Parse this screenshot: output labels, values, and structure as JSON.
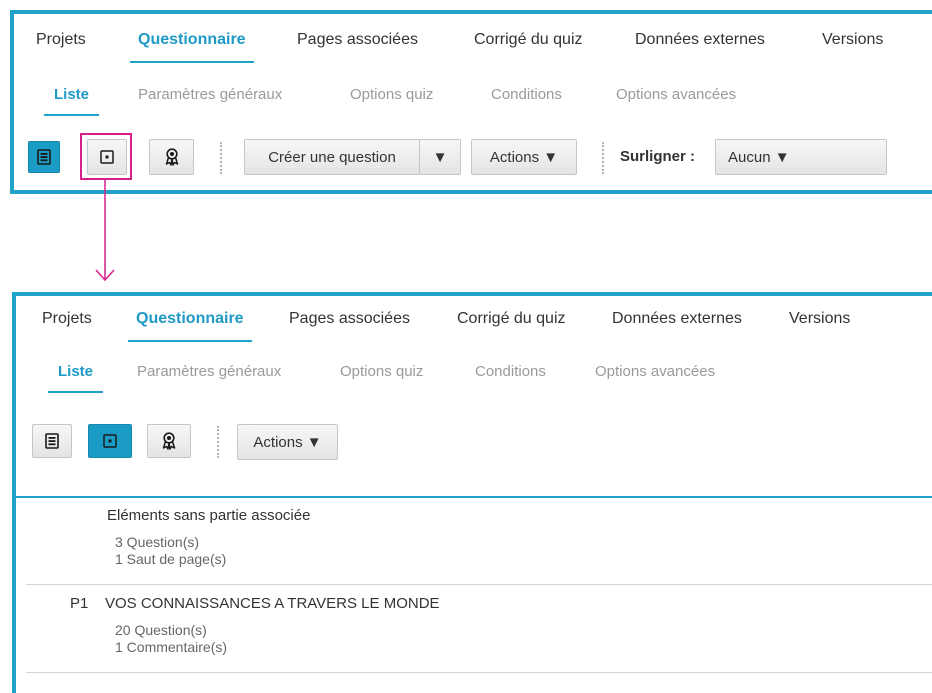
{
  "tabs": [
    "Projets",
    "Questionnaire",
    "Pages associées",
    "Corrigé du quiz",
    "Données externes",
    "Versions"
  ],
  "subtabs": [
    "Liste",
    "Paramètres généraux",
    "Options quiz",
    "Conditions",
    "Options avancées"
  ],
  "toolbar": {
    "create_label": "Créer une question",
    "dropdown_arrow": "▼",
    "actions_label": "Actions ▼",
    "highlight_label": "Surligner :",
    "highlight_value": "Aucun ▼"
  },
  "icons": {
    "list_view": "list-icon",
    "part_view": "square-dot-icon",
    "quiz_view": "award-ribbon-icon"
  },
  "colors": {
    "accent": "#1fa3c9",
    "callout": "#d61f8a"
  },
  "list": {
    "unassigned": {
      "title": "Eléments sans partie associée",
      "lines": [
        "3 Question(s)",
        "1 Saut de page(s)"
      ]
    },
    "parts": [
      {
        "code": "P1",
        "title": "VOS CONNAISSANCES A TRAVERS LE MONDE",
        "lines": [
          "20 Question(s)",
          "1 Commentaire(s)"
        ]
      }
    ]
  }
}
